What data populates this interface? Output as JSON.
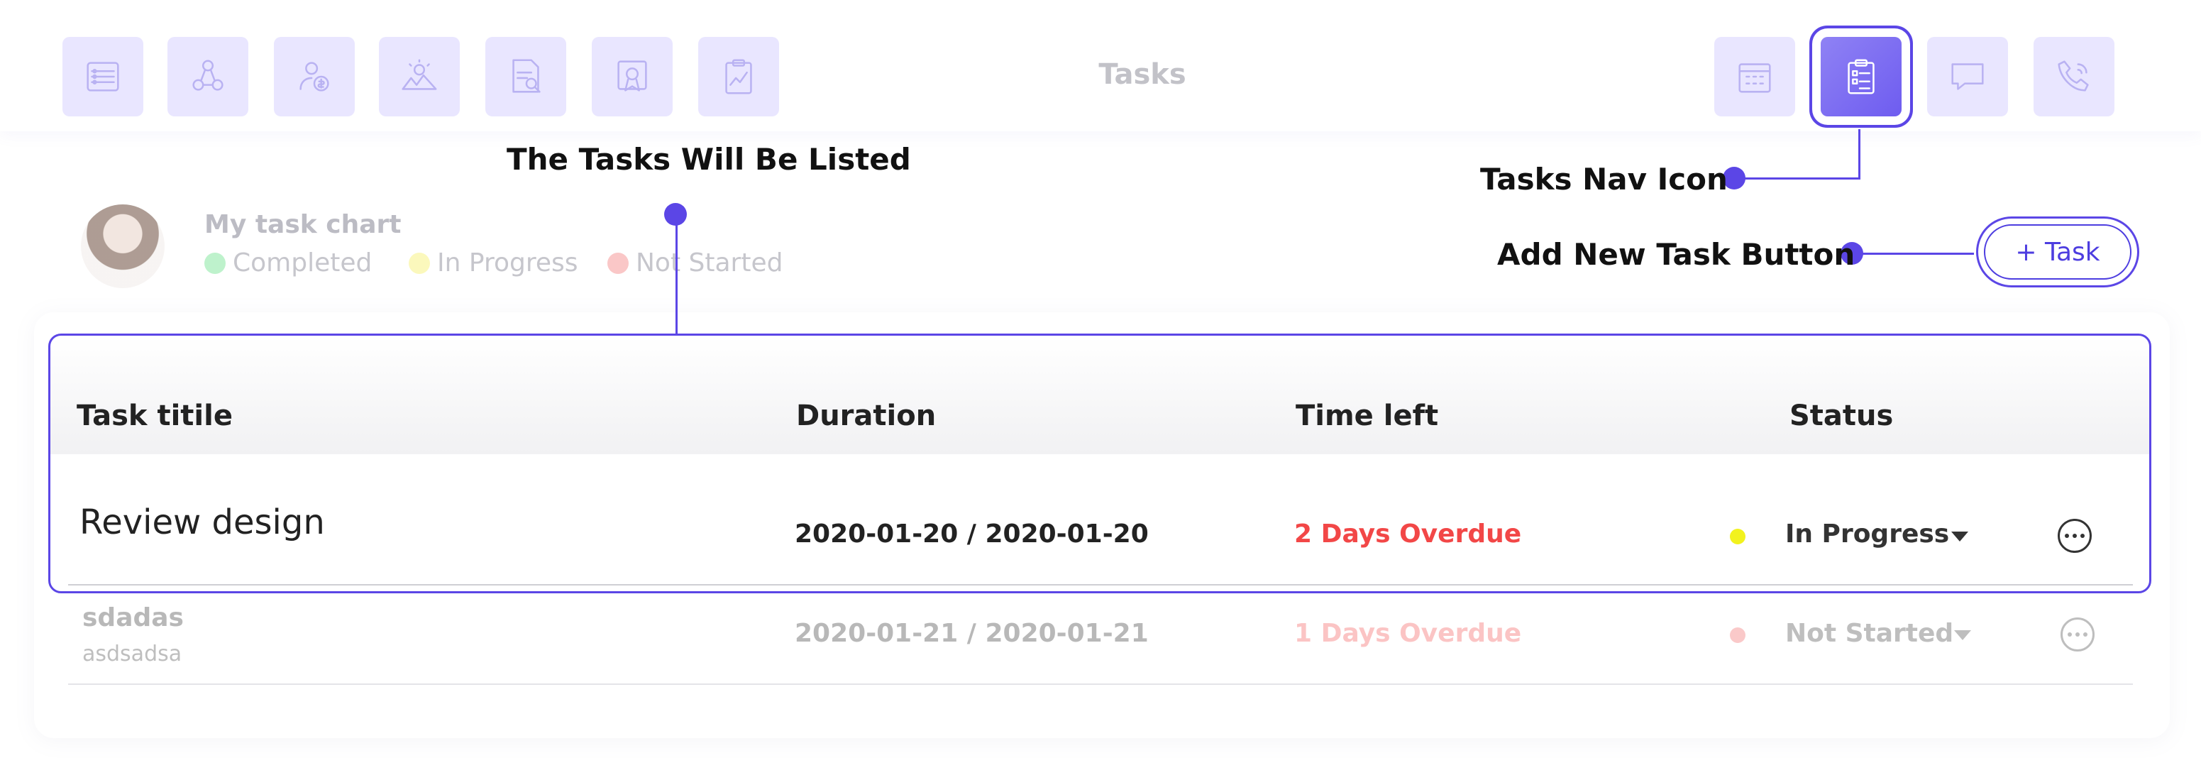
{
  "page_title": "Tasks",
  "nav": {
    "left_icons": [
      "list-icon",
      "network-icon",
      "user-money-icon",
      "landscape-icon",
      "document-search-icon",
      "certificate-icon",
      "clipboard-chart-icon"
    ],
    "right_icons": [
      "calendar-icon",
      "tasks-clipboard-icon",
      "chat-icon",
      "phone-icon"
    ],
    "active": "tasks-clipboard-icon"
  },
  "header": {
    "chart_title": "My task chart",
    "legend": [
      {
        "label": "Completed",
        "color": "#7de59a"
      },
      {
        "label": "In Progress",
        "color": "#f7f27a"
      },
      {
        "label": "Not Started",
        "color": "#f58f8f"
      }
    ],
    "add_task_label": "+ Task"
  },
  "table": {
    "columns": [
      "Task titile",
      "Duration",
      "Time left",
      "Status"
    ],
    "rows": [
      {
        "title": "Review design",
        "subtitle": "",
        "duration": "2020-01-20 / 2020-01-20",
        "time_left": "2 Days Overdue",
        "status": "In Progress",
        "status_color": "#f2f21e"
      },
      {
        "title": "sdadas",
        "subtitle": "asdsadsa",
        "duration": "2020-01-21 / 2020-01-21",
        "time_left": "1 Days Overdue",
        "status": "Not Started",
        "status_color": "#f05555"
      }
    ]
  },
  "annotations": {
    "tasks_listed": "The Tasks Will Be Listed",
    "tasks_nav_icon": "Tasks Nav Icon",
    "add_task_button": "Add New Task Button"
  },
  "colors": {
    "accent": "#5b46e6",
    "overdue": "#f24747",
    "nav_inactive_bg": "#e9e6ff"
  }
}
